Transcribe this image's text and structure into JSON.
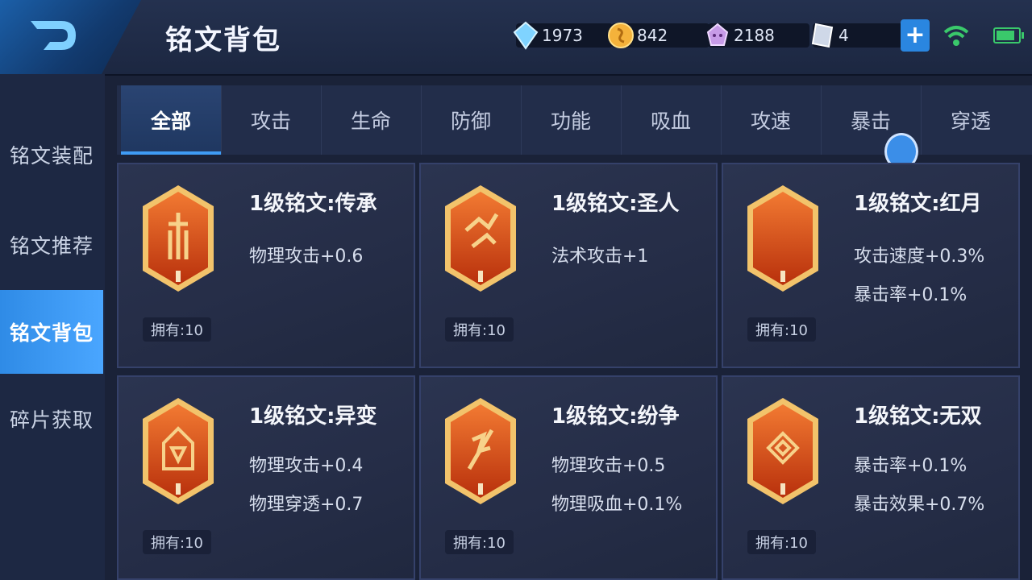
{
  "header": {
    "title": "铭文背包",
    "resources": [
      {
        "name": "diamond",
        "value": "1973",
        "icon": "diamond-icon",
        "color": "#7fd3ff"
      },
      {
        "name": "gold",
        "value": "842",
        "icon": "gold-coin-icon",
        "color": "#f4b23b"
      },
      {
        "name": "crystal",
        "value": "2188",
        "icon": "crystal-icon",
        "color": "#c79be8"
      },
      {
        "name": "fragment",
        "value": "4",
        "icon": "fragment-card-icon",
        "color": "#cfd8e8"
      }
    ],
    "plus_icon": "plus-icon",
    "wifi_icon": "wifi-icon",
    "battery_level": 0.85
  },
  "sidebar": {
    "items": [
      {
        "label": "铭文装配",
        "active": false
      },
      {
        "label": "铭文推荐",
        "active": false
      },
      {
        "label": "铭文背包",
        "active": true
      },
      {
        "label": "碎片获取",
        "active": false
      }
    ]
  },
  "tabs": [
    {
      "label": "全部",
      "active": true
    },
    {
      "label": "攻击",
      "active": false
    },
    {
      "label": "生命",
      "active": false
    },
    {
      "label": "防御",
      "active": false
    },
    {
      "label": "功能",
      "active": false
    },
    {
      "label": "吸血",
      "active": false
    },
    {
      "label": "攻速",
      "active": false
    },
    {
      "label": "暴击",
      "active": false
    },
    {
      "label": "穿透",
      "active": false
    }
  ],
  "cards": [
    {
      "name": "1级铭文:传承",
      "stats": [
        "物理攻击+0.6"
      ],
      "own": "拥有:10",
      "level": "I",
      "icon": "inheritance-emblem-icon"
    },
    {
      "name": "1级铭文:圣人",
      "stats": [
        "法术攻击+1"
      ],
      "own": "拥有:10",
      "level": "I",
      "icon": "sage-emblem-icon"
    },
    {
      "name": "1级铭文:红月",
      "stats": [
        "攻击速度+0.3%",
        "暴击率+0.1%"
      ],
      "own": "拥有:10",
      "level": "I",
      "icon": "red-moon-emblem-icon"
    },
    {
      "name": "1级铭文:异变",
      "stats": [
        "物理攻击+0.4",
        "物理穿透+0.7"
      ],
      "own": "拥有:10",
      "level": "I",
      "icon": "mutation-emblem-icon"
    },
    {
      "name": "1级铭文:纷争",
      "stats": [
        "物理攻击+0.5",
        "物理吸血+0.1%"
      ],
      "own": "拥有:10",
      "level": "I",
      "icon": "strife-emblem-icon"
    },
    {
      "name": "1级铭文:无双",
      "stats": [
        "暴击率+0.1%",
        "暴击效果+0.7%"
      ],
      "own": "拥有:10",
      "level": "I",
      "icon": "peerless-emblem-icon"
    }
  ],
  "colors": {
    "accent": "#3f9cf5",
    "emblem_orange": "#e2561c",
    "emblem_gold": "#f2c36b"
  }
}
